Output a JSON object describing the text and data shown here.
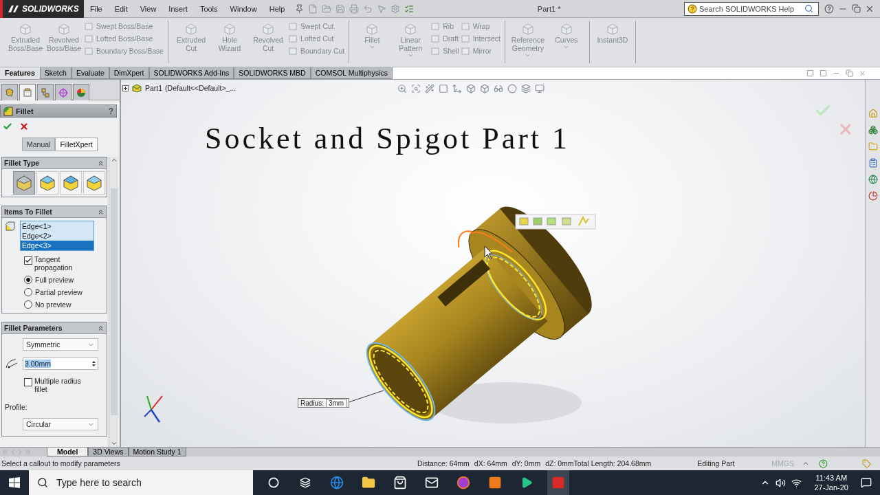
{
  "titlebar": {
    "logo": "SOLIDWORKS",
    "menu": [
      "File",
      "Edit",
      "View",
      "Insert",
      "Tools",
      "Window",
      "Help"
    ],
    "document_title": "Part1 *",
    "search": {
      "placeholder": "Search SOLIDWORKS Help"
    }
  },
  "ribbon": {
    "disabled": true,
    "groups": [
      {
        "items": [
          {
            "kind": "large",
            "label": "Extruded Boss/Base",
            "dropdown": false
          },
          {
            "kind": "large",
            "label": "Revolved Boss/Base",
            "dropdown": false
          },
          {
            "kind": "stack",
            "labels": [
              "Swept Boss/Base",
              "Lofted Boss/Base",
              "Boundary Boss/Base"
            ]
          }
        ]
      },
      {
        "items": [
          {
            "kind": "large",
            "label": "Extruded Cut",
            "dropdown": false
          },
          {
            "kind": "large",
            "label": "Hole Wizard",
            "dropdown": false
          },
          {
            "kind": "large",
            "label": "Revolved Cut",
            "dropdown": false
          },
          {
            "kind": "stack",
            "labels": [
              "Swept Cut",
              "Lofted Cut",
              "Boundary Cut"
            ]
          }
        ]
      },
      {
        "items": [
          {
            "kind": "large",
            "label": "Fillet",
            "dropdown": true
          },
          {
            "kind": "large",
            "label": "Linear Pattern",
            "dropdown": true
          },
          {
            "kind": "stack",
            "labels": [
              "Rib",
              "Draft",
              "Shell"
            ]
          },
          {
            "kind": "stack",
            "labels": [
              "Wrap",
              "Intersect",
              "Mirror"
            ]
          }
        ]
      },
      {
        "items": [
          {
            "kind": "large",
            "label": "Reference Geometry",
            "dropdown": true
          },
          {
            "kind": "large",
            "label": "Curves",
            "dropdown": true
          }
        ]
      },
      {
        "items": [
          {
            "kind": "large",
            "label": "Instant3D",
            "dropdown": false
          }
        ]
      }
    ]
  },
  "command_tabs": [
    {
      "label": "Features",
      "selected": true
    },
    {
      "label": "Sketch",
      "selected": false
    },
    {
      "label": "Evaluate",
      "selected": false
    },
    {
      "label": "DimXpert",
      "selected": false
    },
    {
      "label": "SOLIDWORKS Add-Ins",
      "selected": false
    },
    {
      "label": "SOLIDWORKS MBD",
      "selected": false
    },
    {
      "label": "COMSOL Multiphysics",
      "selected": false
    }
  ],
  "property_manager": {
    "tabs": [
      {
        "selected": false
      },
      {
        "selected": true
      },
      {
        "selected": false
      },
      {
        "selected": false
      },
      {
        "selected": false
      }
    ],
    "title": "Fillet",
    "help": "?",
    "modes": [
      {
        "label": "Manual",
        "selected": true
      },
      {
        "label": "FilletXpert",
        "selected": false
      }
    ],
    "sections": [
      {
        "kind": "fillet_type",
        "title": "Fillet Type",
        "expanded": true,
        "types": [
          {
            "selected": true
          },
          {
            "selected": false
          },
          {
            "selected": false
          },
          {
            "selected": false
          }
        ]
      },
      {
        "kind": "items",
        "title": "Items To Fillet",
        "expanded": true,
        "edges": [
          {
            "label": "Edge<1>",
            "selected": false
          },
          {
            "label": "Edge<2>",
            "selected": false
          },
          {
            "label": "Edge<3>",
            "selected": true
          }
        ],
        "tangent_propagation": {
          "label": "Tangent propagation",
          "checked": true
        },
        "preview": [
          {
            "label": "Full preview",
            "selected": true
          },
          {
            "label": "Partial preview",
            "selected": false
          },
          {
            "label": "No preview",
            "selected": false
          }
        ]
      },
      {
        "kind": "parameters",
        "title": "Fillet Parameters",
        "expanded": true,
        "method": "Symmetric",
        "radius": "3.00mm",
        "multiple_radius": {
          "label": "Multiple radius fillet",
          "checked": false
        },
        "profile_label": "Profile:",
        "profile": "Circular"
      }
    ]
  },
  "viewport": {
    "tree_root": "Part1",
    "configuration": "(Default<<Default>_...",
    "heading": "Socket and Spigot Part 1",
    "callout": {
      "label": "Radius:",
      "value": "3mm"
    }
  },
  "bottom_tabs": [
    {
      "label": "Model",
      "selected": true
    },
    {
      "label": "3D Views",
      "selected": false
    },
    {
      "label": "Motion Study 1",
      "selected": false
    }
  ],
  "status_bar": {
    "message": "Select a callout to modify parameters",
    "measures": [
      "Distance: 64mm",
      "dX: 64mm",
      "dY: 0mm",
      "dZ: 0mmTotal Length: 204.68mm"
    ],
    "mode": "Editing Part",
    "units": "MMGS"
  },
  "taskbar": {
    "search": {
      "placeholder": "Type here to search"
    },
    "time": "11:43 AM",
    "date": "27-Jan-20"
  }
}
